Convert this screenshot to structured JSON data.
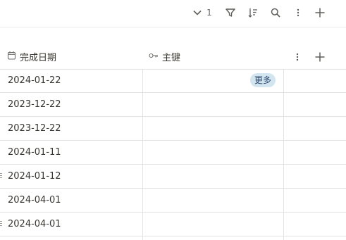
{
  "toolbar": {
    "count": "1",
    "icons": [
      "chevron-down-icon",
      "filter-icon",
      "sort-icon",
      "search-icon",
      "more-icon",
      "add-icon"
    ]
  },
  "columns": [
    {
      "label": "完成日期",
      "icon": "calendar-icon"
    },
    {
      "label": "主键",
      "icon": "key-icon"
    }
  ],
  "rows": [
    {
      "date": "2024-01-22",
      "tag": "更多"
    },
    {
      "date": "2023-12-22",
      "tag": ""
    },
    {
      "date": "2023-12-22",
      "tag": ""
    },
    {
      "date": "2024-01-11",
      "tag": ""
    },
    {
      "date": "2024-01-12",
      "tag": ""
    },
    {
      "date": "2024-04-01",
      "tag": ""
    },
    {
      "date": "2024-04-01",
      "tag": ""
    }
  ],
  "colors": {
    "tag_bg": "#d3e5ef",
    "tag_text": "#28456c",
    "border": "#e3e3e3"
  }
}
